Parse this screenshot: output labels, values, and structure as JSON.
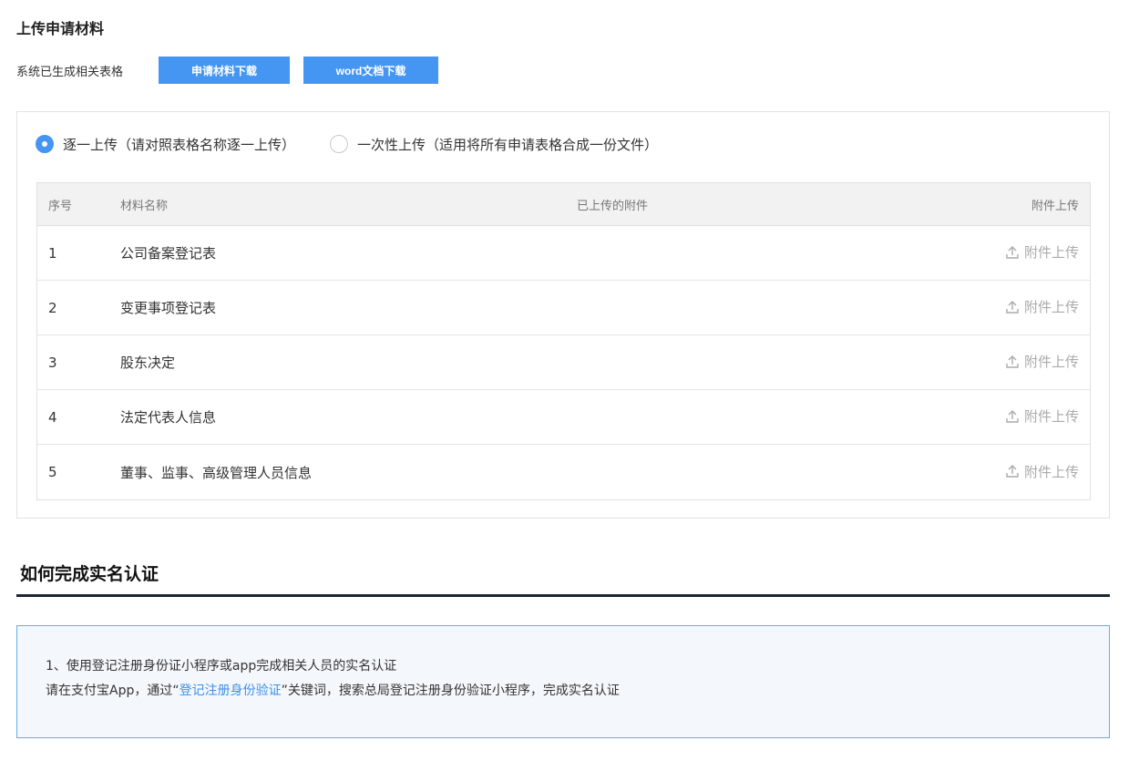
{
  "upload_section": {
    "title": "上传申请材料",
    "generated_label": "系统已生成相关表格",
    "apply_download_label": "申请材料下载",
    "word_download_label": "word文档下载"
  },
  "upload_mode": {
    "option_one": "逐一上传（请对照表格名称逐一上传）",
    "option_batch": "一次性上传（适用将所有申请表格合成一份文件）",
    "selected": "option_one"
  },
  "table": {
    "headers": {
      "index": "序号",
      "name": "材料名称",
      "attachments": "已上传的附件",
      "upload": "附件上传"
    },
    "rows": [
      {
        "index": "1",
        "name": "公司备案登记表",
        "upload_label": "附件上传"
      },
      {
        "index": "2",
        "name": "变更事项登记表",
        "upload_label": "附件上传"
      },
      {
        "index": "3",
        "name": "股东决定",
        "upload_label": "附件上传"
      },
      {
        "index": "4",
        "name": "法定代表人信息",
        "upload_label": "附件上传"
      },
      {
        "index": "5",
        "name": "董事、监事、高级管理人员信息",
        "upload_label": "附件上传"
      }
    ]
  },
  "realname": {
    "title": "如何完成实名认证",
    "step_line": "1、使用登记注册身份证小程序或app完成相关人员的实名认证",
    "instruction_prefix": "请在支付宝App，通过“",
    "instruction_link": "登记注册身份验证",
    "instruction_suffix": "”关键词，搜索总局登记注册身份验证小程序，完成实名认证"
  },
  "colors": {
    "accent": "#4596f2",
    "link": "#3f8ee8",
    "info_bg": "#f4f8fd",
    "info_border": "#6aa9e9"
  }
}
